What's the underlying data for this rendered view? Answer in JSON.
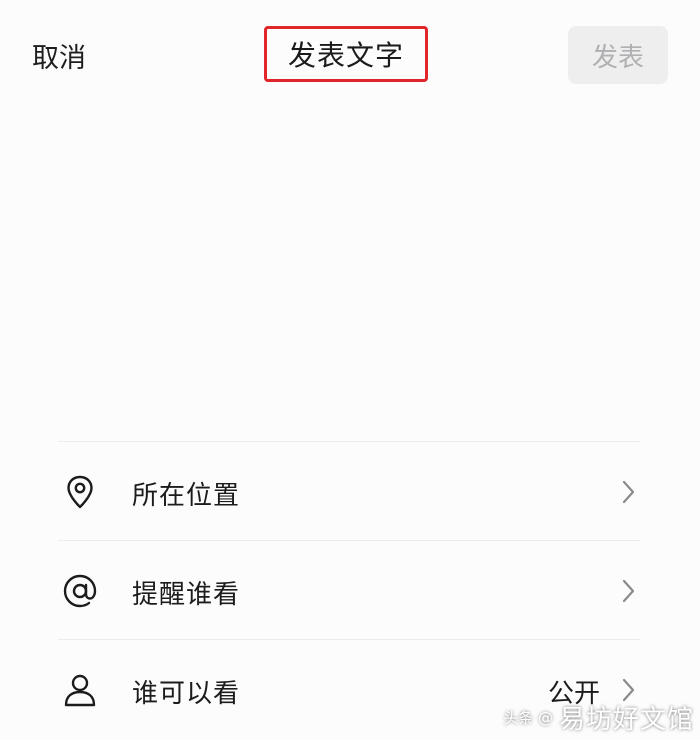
{
  "header": {
    "cancel_label": "取消",
    "title": "发表文字",
    "publish_label": "发表"
  },
  "options": [
    {
      "id": "location",
      "icon": "location-pin-icon",
      "label": "所在位置",
      "value": ""
    },
    {
      "id": "mention",
      "icon": "at-sign-icon",
      "label": "提醒谁看",
      "value": ""
    },
    {
      "id": "visibility",
      "icon": "person-icon",
      "label": "谁可以看",
      "value": "公开"
    }
  ],
  "watermark": {
    "small": "头条 @",
    "large": "易坊好文馆"
  },
  "colors": {
    "highlight_border": "#e0262b",
    "publish_disabled_bg": "#eeeeef",
    "publish_disabled_text": "#b0b0b2"
  }
}
